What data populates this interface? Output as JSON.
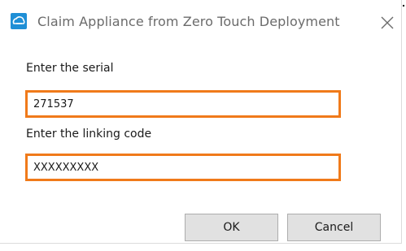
{
  "dialog": {
    "title": "Claim Appliance from Zero Touch Deployment",
    "icon": "cloud-sync-icon",
    "close_icon": "close-icon"
  },
  "form": {
    "serial_label": "Enter the serial",
    "serial_value": "271537",
    "linking_label": "Enter the linking code",
    "linking_value": "XXXXXXXXX"
  },
  "buttons": {
    "ok": "OK",
    "cancel": "Cancel"
  },
  "colors": {
    "highlight": "#f07a1a",
    "icon_blue": "#1f8fd6"
  }
}
